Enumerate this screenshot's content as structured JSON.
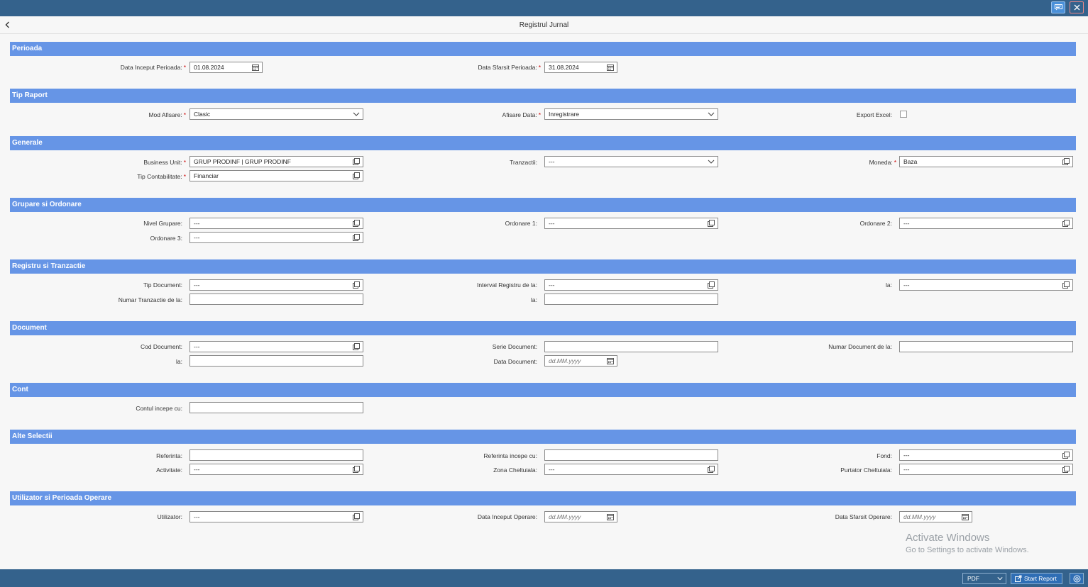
{
  "window": {
    "title": "Registrul Jurnal"
  },
  "sections": {
    "perioada": "Perioada",
    "tip_raport": "Tip Raport",
    "generale": "Generale",
    "grupare": "Grupare si Ordonare",
    "registru": "Registru si Tranzactie",
    "document": "Document",
    "cont": "Cont",
    "alte": "Alte Selectii",
    "utilizator": "Utilizator si Perioada Operare"
  },
  "perioada": {
    "data_inceput": {
      "label": "Data Inceput Perioada:",
      "value": "01.08.2024"
    },
    "data_sfarsit": {
      "label": "Data Sfarsit Perioada:",
      "value": "31.08.2024"
    }
  },
  "tip_raport": {
    "mod_afisare": {
      "label": "Mod Afisare:",
      "value": "Clasic"
    },
    "afisare_data": {
      "label": "Afisare Data:",
      "value": "Inregistrare"
    },
    "export_excel": {
      "label": "Export Excel:",
      "checked": false
    }
  },
  "generale": {
    "business_unit": {
      "label": "Business Unit:",
      "value": "GRUP PRODINF | GRUP PRODINF"
    },
    "tranzactii": {
      "label": "Tranzactii:",
      "value": "---"
    },
    "moneda": {
      "label": "Moneda:",
      "value": "Baza"
    },
    "tip_contabilitate": {
      "label": "Tip Contabilitate:",
      "value": "Financiar"
    }
  },
  "grupare": {
    "nivel_grupare": {
      "label": "Nivel Grupare:",
      "value": "---"
    },
    "ordonare1": {
      "label": "Ordonare 1:",
      "value": "---"
    },
    "ordonare2": {
      "label": "Ordonare 2:",
      "value": "---"
    },
    "ordonare3": {
      "label": "Ordonare 3:",
      "value": "---"
    }
  },
  "registru": {
    "tip_document": {
      "label": "Tip Document:",
      "value": "---"
    },
    "interval_registru": {
      "label": "Interval Registru de la:",
      "value": "---"
    },
    "la_registru": {
      "label": "la:",
      "value": "---"
    },
    "numar_tranzactie": {
      "label": "Numar Tranzactie de la:",
      "value": ""
    },
    "la_tranzactie": {
      "label": "la:",
      "value": ""
    }
  },
  "document": {
    "cod_document": {
      "label": "Cod Document:",
      "value": "---"
    },
    "serie_document": {
      "label": "Serie Document:",
      "value": ""
    },
    "numar_document": {
      "label": "Numar Document de la:",
      "value": ""
    },
    "la_cod": {
      "label": "la:",
      "value": ""
    },
    "data_document": {
      "label": "Data Document:",
      "placeholder": "dd.MM.yyyy"
    }
  },
  "cont": {
    "contul_incepe": {
      "label": "Contul incepe cu:",
      "value": ""
    }
  },
  "alte": {
    "referinta": {
      "label": "Referinta:",
      "value": ""
    },
    "referinta_incepe": {
      "label": "Referinta incepe cu:",
      "value": ""
    },
    "fond": {
      "label": "Fond:",
      "value": "---"
    },
    "activitate": {
      "label": "Activitate:",
      "value": "---"
    },
    "zona_cheltuiala": {
      "label": "Zona Cheltuiala:",
      "value": "---"
    },
    "purtator": {
      "label": "Purtator Cheltuiala:",
      "value": "---"
    }
  },
  "utilizator": {
    "utilizator": {
      "label": "Utilizator:",
      "value": "---"
    },
    "data_inceput_operare": {
      "label": "Data Inceput Operare:",
      "placeholder": "dd.MM.yyyy"
    },
    "data_sfarsit_operare": {
      "label": "Data Sfarsit Operare:",
      "placeholder": "dd.MM.yyyy"
    }
  },
  "watermark": {
    "line1": "Activate Windows",
    "line2": "Go to Settings to activate Windows."
  },
  "footer": {
    "format": "PDF",
    "start_label": "Start Report"
  },
  "colors": {
    "header_bar": "#34628c",
    "section_bar": "#6695e6",
    "required": "#cc0000"
  }
}
